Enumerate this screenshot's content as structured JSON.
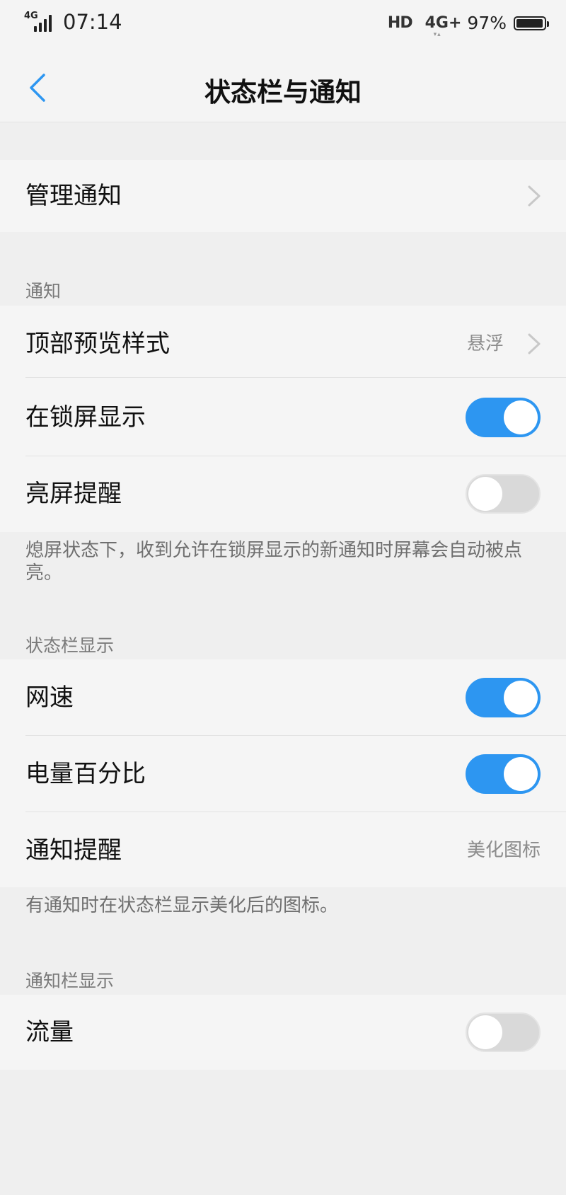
{
  "status_bar": {
    "network_left": "4G",
    "time": "07:14",
    "hd": "HD",
    "network_right": "4G+",
    "battery_percent_text": "97%",
    "battery_level": 0.97
  },
  "header": {
    "title": "状态栏与通知",
    "back_icon": "chevron-left-icon"
  },
  "manage": {
    "label": "管理通知"
  },
  "notifications": {
    "section_title": "通知",
    "top_preview_label": "顶部预览样式",
    "top_preview_value": "悬浮",
    "lockscreen_label": "在锁屏显示",
    "lockscreen_on": true,
    "wake_label": "亮屏提醒",
    "wake_on": false,
    "footnote": "熄屏状态下，收到允许在锁屏显示的新通知时屏幕会自动被点亮。"
  },
  "status_bar_display": {
    "section_title": "状态栏显示",
    "net_speed_label": "网速",
    "net_speed_on": true,
    "battery_pct_label": "电量百分比",
    "battery_pct_on": true,
    "notify_remind_label": "通知提醒",
    "notify_remind_value": "美化图标",
    "footnote": "有通知时在状态栏显示美化后的图标。"
  },
  "notification_bar_display": {
    "section_title": "通知栏显示",
    "traffic_label": "流量",
    "traffic_on": false
  },
  "colors": {
    "accent": "#2d96f1",
    "toggle_off": "#d9d9d9",
    "background": "#efefef"
  }
}
